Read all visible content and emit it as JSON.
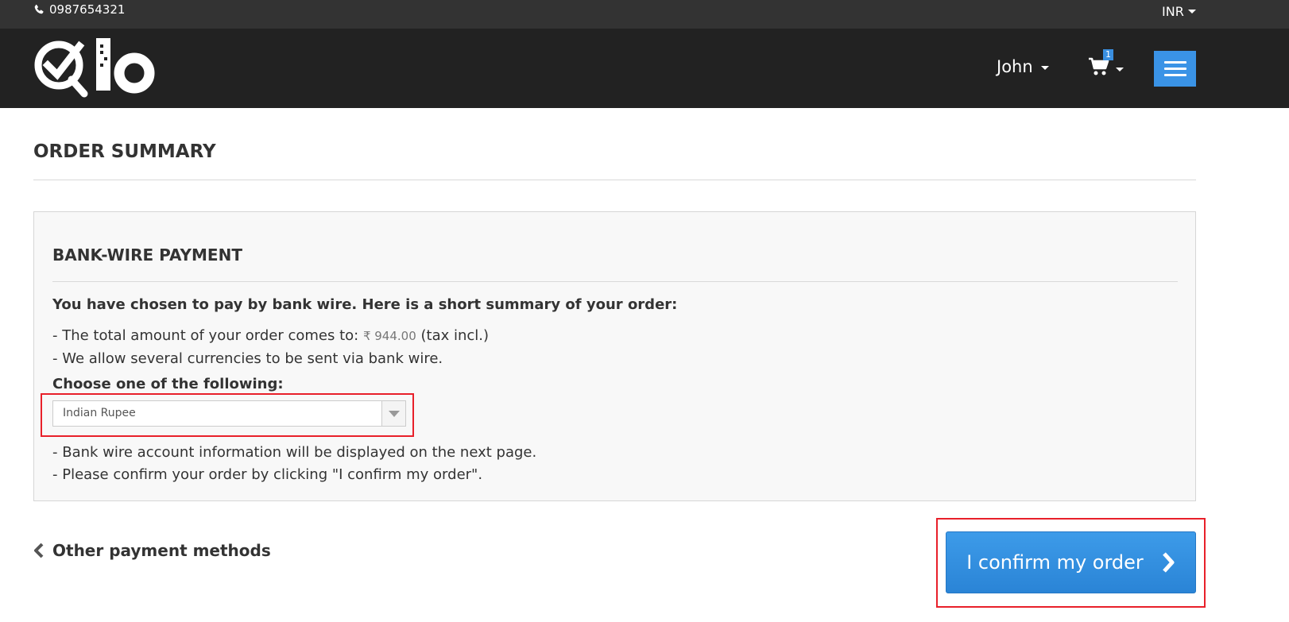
{
  "topbar": {
    "phone": "0987654321",
    "phone_icon": "phone-icon",
    "currency": "INR"
  },
  "header": {
    "logo_icon": "qlo-logo",
    "user_name": "John",
    "cart_count": "1",
    "cart_icon": "shopping-cart-icon",
    "menu_icon": "hamburger-menu-icon"
  },
  "page": {
    "title": "ORDER SUMMARY"
  },
  "payment": {
    "title": "BANK-WIRE PAYMENT",
    "lead": "You have chosen to pay by bank wire. Here is a short summary of your order:",
    "total_prefix": "- The total amount of your order comes to:",
    "total_amount": "₹ 944.00",
    "total_suffix": "(tax incl.)",
    "currencies_note": "- We allow several currencies to be sent via bank wire.",
    "choose_label": "Choose one of the following:",
    "currency_select": {
      "selected": "Indian Rupee"
    },
    "account_info_note": "- Bank wire account information will be displayed on the next page.",
    "confirm_note": "- Please confirm your order by clicking \"I confirm my order\"."
  },
  "actions": {
    "back_label": "Other payment methods",
    "confirm_label": "I confirm my order"
  },
  "colors": {
    "topbar_bg": "#333333",
    "header_bg": "#222222",
    "accent_blue": "#3a93e6",
    "highlight_red": "#e8202a"
  }
}
